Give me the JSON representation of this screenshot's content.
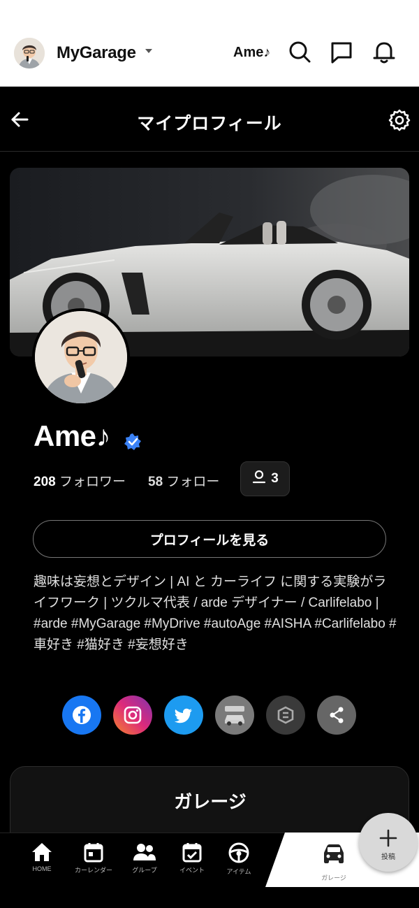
{
  "appbar": {
    "brand": "MyGarage",
    "username": "Ame♪",
    "icons": [
      "avatar",
      "caret-down-icon",
      "search-icon",
      "message-icon",
      "bell-icon"
    ]
  },
  "pagehead": {
    "title": "マイプロフィール",
    "icons": [
      "back-arrow-icon",
      "gear-icon"
    ]
  },
  "profile": {
    "name": "Ame♪",
    "followers_count": "208",
    "followers_label": "フォロワー",
    "following_count": "58",
    "following_label": "フォロー",
    "groups_count": "3",
    "view_profile_button": "プロフィールを見る",
    "bio": "趣味は妄想とデザイン | AI と カーライフ に関する実験がライフワーク | ツクルマ代表 / arde デザイナー / Carlifelabo | #arde #MyGarage #MyDrive #autoAge #AISHA #Carlifelabo #車好き #猫好き #妄想好き"
  },
  "socials": [
    {
      "name": "facebook",
      "color": "#1877f2"
    },
    {
      "name": "instagram",
      "color": "#d62976"
    },
    {
      "name": "twitter",
      "color": "#1d9bf0"
    },
    {
      "name": "minkara",
      "color": "#777777"
    },
    {
      "name": "carlifelabo",
      "color": "#3a3a3a"
    },
    {
      "name": "share",
      "color": "#666666"
    }
  ],
  "garage_section": {
    "title": "ガレージ"
  },
  "bottomnav": {
    "items": [
      {
        "label": "HOME"
      },
      {
        "label": "カーレンダー"
      },
      {
        "label": "グループ"
      },
      {
        "label": "イベント"
      },
      {
        "label": "アイテム"
      },
      {
        "label": "ガレージ"
      }
    ],
    "fab_label": "投稿"
  },
  "colors": {
    "verified": "#3b82f6",
    "background": "#000000"
  }
}
